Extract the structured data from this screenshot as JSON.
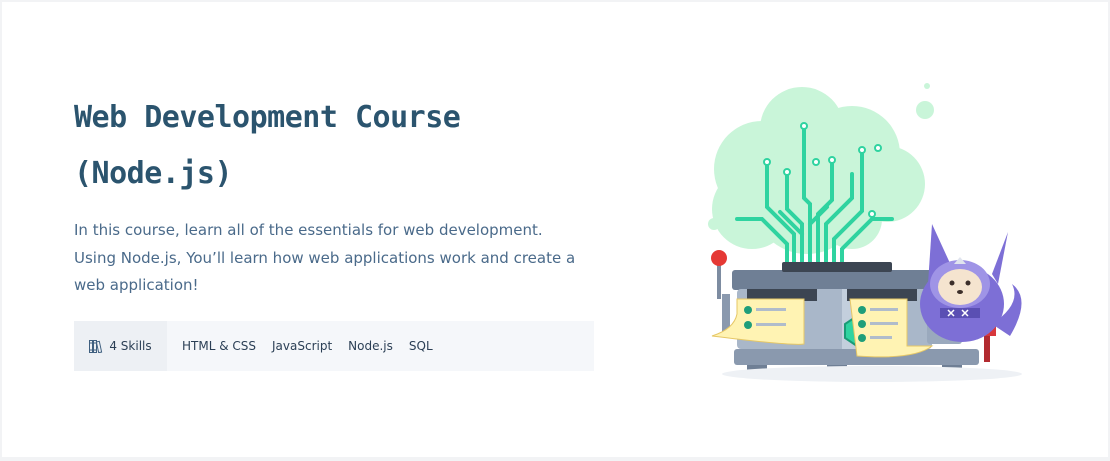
{
  "course": {
    "title_line1": "Web Development Course",
    "title_line2": "(Node.js)",
    "description": [
      "In this course, learn all of the essentials for web development.",
      "Using Node.js, You’ll learn how web applications work and create a web application!"
    ],
    "skills": {
      "count_label": "4 Skills",
      "icon": "books-icon",
      "tags": [
        "HTML & CSS",
        "JavaScript",
        "Node.js",
        "SQL"
      ]
    }
  },
  "colors": {
    "title": "#2b546e",
    "text": "#4a6a8a",
    "accent_green": "#2fd3a0",
    "mascot": "#7d6fd6"
  },
  "illustration": {
    "name": "code-machine-illustration"
  }
}
